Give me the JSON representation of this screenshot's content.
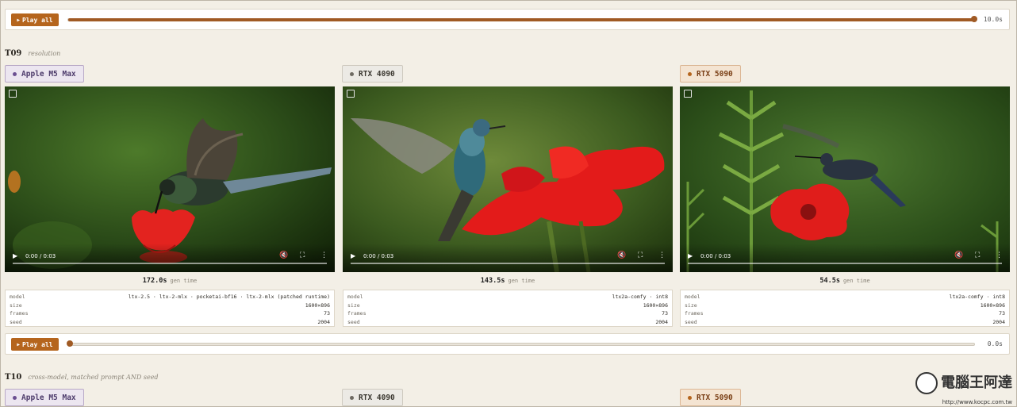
{
  "playbar_top": {
    "button_label": "Play all",
    "time": "10.0s",
    "progress": 1.0
  },
  "section_t09": {
    "id": "T09",
    "subtitle": "resolution"
  },
  "badges": {
    "m5": "Apple M5 Max",
    "rtx4090": "RTX 4090",
    "rtx5090": "RTX 5090"
  },
  "videos": [
    {
      "time": "0:00 / 0:03"
    },
    {
      "time": "0:00 / 0:03"
    },
    {
      "time": "0:00 / 0:03"
    }
  ],
  "gen_label": "gen time",
  "results": [
    {
      "gen_time": "172.0s",
      "model": "ltx-2.5 · ltx-2-mlx · pocketai-bf16 · ltx-2-mlx (patched runtime)",
      "size": "1600×896",
      "frames": "73",
      "seed": "2004"
    },
    {
      "gen_time": "143.5s",
      "model": "ltx2a-comfy · int8",
      "size": "1600×896",
      "frames": "73",
      "seed": "2004"
    },
    {
      "gen_time": "54.5s",
      "model": "ltx2a-comfy · int8",
      "size": "1600×896",
      "frames": "73",
      "seed": "2004"
    }
  ],
  "meta_keys": {
    "model": "model",
    "size": "size",
    "frames": "frames",
    "seed": "seed"
  },
  "playbar_bottom": {
    "button_label": "Play all",
    "time": "0.0s",
    "progress": 0.0
  },
  "section_t10": {
    "id": "T10",
    "subtitle": "cross-model, matched prompt AND seed"
  },
  "watermark": {
    "text": "電腦王阿達",
    "url": "http://www.kocpc.com.tw"
  },
  "colors": {
    "accent": "#b5651d",
    "background": "#f3efe6"
  }
}
